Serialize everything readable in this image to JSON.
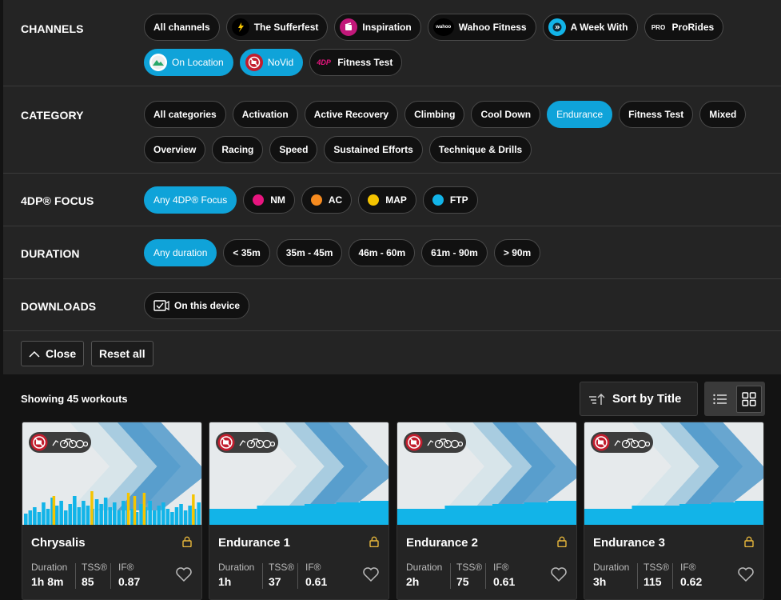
{
  "filters": {
    "channels": {
      "label": "CHANNELS",
      "items": [
        {
          "label": "All channels",
          "selected": false
        },
        {
          "label": "The Sufferfest",
          "selected": false,
          "icon": "sufferfest-icon"
        },
        {
          "label": "Inspiration",
          "selected": false,
          "icon": "inspiration-icon"
        },
        {
          "label": "Wahoo Fitness",
          "selected": false,
          "icon": "wahoo-icon",
          "icon_text": "wahoo"
        },
        {
          "label": "A Week With",
          "selected": false,
          "icon": "a-week-with-icon"
        },
        {
          "label": "ProRides",
          "selected": false,
          "icon": "prorides-icon",
          "icon_text": "PRO"
        },
        {
          "label": "On Location",
          "selected": true,
          "icon": "on-location-icon"
        },
        {
          "label": "NoVid",
          "selected": true,
          "icon": "novid-icon"
        },
        {
          "label": "Fitness Test",
          "selected": false,
          "icon": "4dp-icon",
          "icon_text": "4DP"
        }
      ]
    },
    "category": {
      "label": "CATEGORY",
      "items": [
        {
          "label": "All categories",
          "selected": false
        },
        {
          "label": "Activation",
          "selected": false
        },
        {
          "label": "Active Recovery",
          "selected": false
        },
        {
          "label": "Climbing",
          "selected": false
        },
        {
          "label": "Cool Down",
          "selected": false
        },
        {
          "label": "Endurance",
          "selected": true
        },
        {
          "label": "Fitness Test",
          "selected": false
        },
        {
          "label": "Mixed",
          "selected": false
        },
        {
          "label": "Overview",
          "selected": false
        },
        {
          "label": "Racing",
          "selected": false
        },
        {
          "label": "Speed",
          "selected": false
        },
        {
          "label": "Sustained Efforts",
          "selected": false
        },
        {
          "label": "Technique & Drills",
          "selected": false
        }
      ]
    },
    "focus": {
      "label": "4DP® FOCUS",
      "items": [
        {
          "label": "Any 4DP® Focus",
          "selected": true
        },
        {
          "label": "NM",
          "selected": false,
          "color": "#e8157f"
        },
        {
          "label": "AC",
          "selected": false,
          "color": "#f68b1f"
        },
        {
          "label": "MAP",
          "selected": false,
          "color": "#f5c400"
        },
        {
          "label": "FTP",
          "selected": false,
          "color": "#12b4e8"
        }
      ]
    },
    "duration": {
      "label": "DURATION",
      "items": [
        {
          "label": "Any duration",
          "selected": true
        },
        {
          "label": "< 35m",
          "selected": false
        },
        {
          "label": "35m - 45m",
          "selected": false
        },
        {
          "label": "46m - 60m",
          "selected": false
        },
        {
          "label": "61m - 90m",
          "selected": false
        },
        {
          "label": "> 90m",
          "selected": false
        }
      ]
    },
    "downloads": {
      "label": "DOWNLOADS",
      "items": [
        {
          "label": "On this device",
          "selected": false,
          "icon": "device-download-icon"
        }
      ]
    },
    "close_label": "Close",
    "reset_label": "Reset all"
  },
  "results": {
    "showing": "Showing 45 workouts",
    "sort_label": "Sort by Title"
  },
  "workouts": [
    {
      "title": "Chrysalis",
      "duration_label": "Duration",
      "duration": "1h 8m",
      "tss_label": "TSS®",
      "tss": "85",
      "if_label": "IF®",
      "if": "0.87"
    },
    {
      "title": "Endurance 1",
      "duration_label": "Duration",
      "duration": "1h",
      "tss_label": "TSS®",
      "tss": "37",
      "if_label": "IF®",
      "if": "0.61"
    },
    {
      "title": "Endurance 2",
      "duration_label": "Duration",
      "duration": "2h",
      "tss_label": "TSS®",
      "tss": "75",
      "if_label": "IF®",
      "if": "0.61"
    },
    {
      "title": "Endurance 3",
      "duration_label": "Duration",
      "duration": "3h",
      "tss_label": "TSS®",
      "tss": "115",
      "if_label": "IF®",
      "if": "0.62"
    }
  ],
  "colors": {
    "accent": "#0fa3d9",
    "lock": "#e9b83b",
    "chart_bar": "#12b4e8",
    "chart_peak": "#f5c400"
  }
}
